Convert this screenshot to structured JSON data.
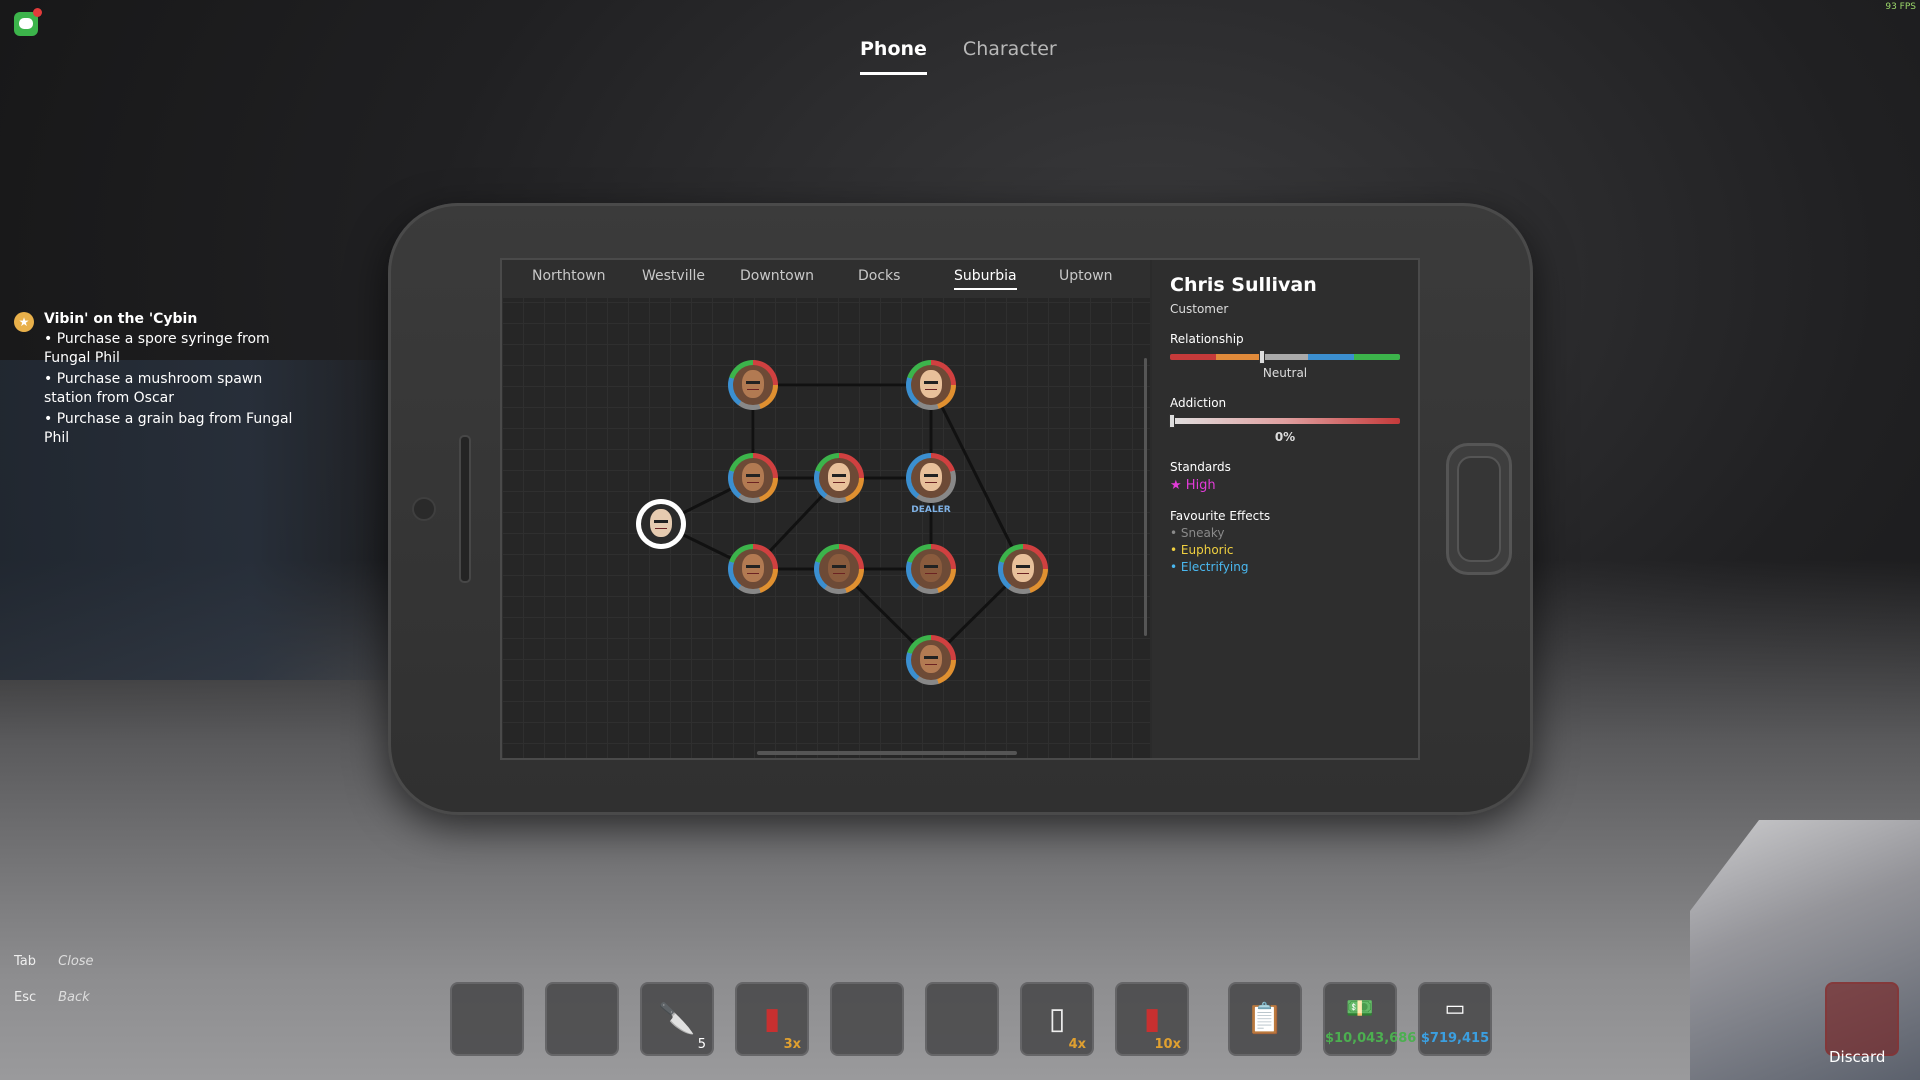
{
  "hud": {
    "fps": "93 FPS"
  },
  "top_tabs": [
    {
      "label": "Phone",
      "active": true
    },
    {
      "label": "Character",
      "active": false
    }
  ],
  "quest": {
    "title": "Vibin' on the 'Cybin",
    "items": [
      "• Purchase a spore syringe from Fungal Phil",
      "• Purchase a mushroom spawn station from Oscar",
      "• Purchase a grain bag from Fungal Phil"
    ]
  },
  "regions": [
    "Northtown",
    "Westville",
    "Downtown",
    "Docks",
    "Suburbia",
    "Uptown"
  ],
  "active_region": "Suburbia",
  "map": {
    "dealer_tag": "DEALER"
  },
  "contact": {
    "name": "Chris Sullivan",
    "role": "Customer",
    "relationship_label": "Relationship",
    "relationship_value": "Neutral",
    "relationship_level": 0.4,
    "addiction_label": "Addiction",
    "addiction_value": "0%",
    "addiction_level": 0.0,
    "standards_label": "Standards",
    "standards_value": "High",
    "effects_label": "Favourite Effects",
    "effects": [
      {
        "name": "Sneaky",
        "color": "#8a8a8a"
      },
      {
        "name": "Euphoric",
        "color": "#f0d040"
      },
      {
        "name": "Electrifying",
        "color": "#4ab8f0"
      }
    ]
  },
  "hints": [
    {
      "key": "Tab",
      "action": "Close"
    },
    {
      "key": "Esc",
      "action": "Back"
    }
  ],
  "hotbar": [
    {
      "icon": "",
      "qty": ""
    },
    {
      "icon": "",
      "qty": ""
    },
    {
      "icon": "knife-icon",
      "qty": "5"
    },
    {
      "icon": "shotgun-shell-icon",
      "qty": "3x"
    },
    {
      "icon": "",
      "qty": ""
    },
    {
      "icon": "",
      "qty": ""
    },
    {
      "icon": "spray-can-icon",
      "qty": "4x"
    },
    {
      "icon": "shotgun-shell-icon",
      "qty": "10x"
    }
  ],
  "tools": {
    "clipboard": "clipboard-icon",
    "cash": "$10,043,686",
    "cash_color": "#4caf50",
    "card": "$719,415",
    "card_color": "#3b9fe0"
  },
  "discard_label": "Discard"
}
